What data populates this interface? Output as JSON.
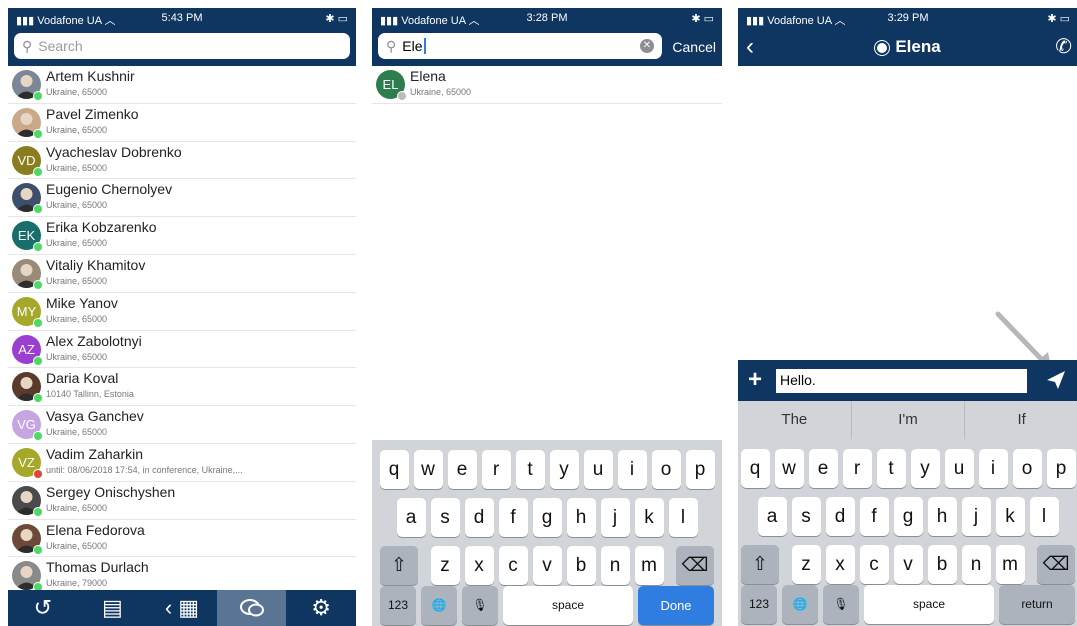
{
  "screens": [
    {
      "status": {
        "carrier": "Vodafone UA",
        "time": "5:43 PM"
      },
      "search_placeholder": "Search",
      "contacts": [
        {
          "name": "Artem Kushnir",
          "sub": "Ukraine, 65000",
          "initials": "",
          "color": "#7b8796",
          "presence": "#4cd964"
        },
        {
          "name": "Pavel Zimenko",
          "sub": "Ukraine, 65000",
          "initials": "",
          "color": "#c9a98a",
          "presence": "#4cd964"
        },
        {
          "name": "Vyacheslav Dobrenko",
          "sub": "Ukraine, 65000",
          "initials": "VD",
          "color": "#8a7d1f",
          "presence": "#4cd964"
        },
        {
          "name": "Eugenio Chernolyev",
          "sub": "Ukraine, 65000",
          "initials": "",
          "color": "#3d4f6b",
          "presence": "#4cd964"
        },
        {
          "name": "Erika Kobzarenko",
          "sub": "Ukraine, 65000",
          "initials": "EK",
          "color": "#176e6a",
          "presence": "#4cd964"
        },
        {
          "name": "Vitaliy Khamitov",
          "sub": "Ukraine, 65000",
          "initials": "",
          "color": "#9a8a7a",
          "presence": "#4cd964"
        },
        {
          "name": "Mike Yanov",
          "sub": "Ukraine, 65000",
          "initials": "MY",
          "color": "#a5a829",
          "presence": "#4cd964"
        },
        {
          "name": "Alex Zabolotnyi",
          "sub": "Ukraine, 65000",
          "initials": "AZ",
          "color": "#9a3fcf",
          "presence": "#4cd964"
        },
        {
          "name": "Daria Koval",
          "sub": "10140 Tallinn, Estonia",
          "initials": "",
          "color": "#5a3a2a",
          "presence": "#4cd964"
        },
        {
          "name": "Vasya Ganchev",
          "sub": "Ukraine, 65000",
          "initials": "VG",
          "color": "#c6a6e0",
          "presence": "#4cd964"
        },
        {
          "name": "Vadim Zaharkin",
          "sub": "until: 08/06/2018 17:54, in conference, Ukraine,...",
          "initials": "VZ",
          "color": "#a5a829",
          "presence": "#e0453a"
        },
        {
          "name": "Sergey Onischyshen",
          "sub": "Ukraine, 65000",
          "initials": "",
          "color": "#4a4a4a",
          "presence": "#4cd964"
        },
        {
          "name": "Elena Fedorova",
          "sub": "Ukraine, 65000",
          "initials": "",
          "color": "#6b4a3a",
          "presence": "#4cd964"
        },
        {
          "name": "Thomas Durlach",
          "sub": "Ukraine, 79000",
          "initials": "",
          "color": "#8a8a8a",
          "presence": "#4cd964"
        }
      ],
      "tabs": [
        {
          "icon": "history-icon",
          "glyph": "↺"
        },
        {
          "icon": "notebook-icon",
          "glyph": "▤"
        },
        {
          "icon": "dialpad-icon",
          "glyph": "‹ ▦"
        },
        {
          "icon": "chat-icon",
          "glyph": "💬"
        },
        {
          "icon": "settings-icon",
          "glyph": "⚙"
        }
      ]
    },
    {
      "status": {
        "carrier": "Vodafone UA",
        "time": "3:28 PM"
      },
      "search_value": "Ele",
      "cancel_label": "Cancel",
      "result": {
        "name": "Elena",
        "sub": "Ukraine, 65000",
        "initials": "EL",
        "color": "#2e7d4f"
      },
      "keyboard": {
        "row1": [
          "q",
          "w",
          "e",
          "r",
          "t",
          "y",
          "u",
          "i",
          "o",
          "p"
        ],
        "row2": [
          "a",
          "s",
          "d",
          "f",
          "g",
          "h",
          "j",
          "k",
          "l"
        ],
        "row3": [
          "z",
          "x",
          "c",
          "v",
          "b",
          "n",
          "m"
        ],
        "num": "123",
        "space": "space",
        "action": "Done"
      }
    },
    {
      "status": {
        "carrier": "Vodafone UA",
        "time": "3:29 PM"
      },
      "title": "Elena",
      "message_value": "Hello.",
      "suggestions": [
        "The",
        "I'm",
        "If"
      ],
      "keyboard": {
        "row1": [
          "q",
          "w",
          "e",
          "r",
          "t",
          "y",
          "u",
          "i",
          "o",
          "p"
        ],
        "row2": [
          "a",
          "s",
          "d",
          "f",
          "g",
          "h",
          "j",
          "k",
          "l"
        ],
        "row3": [
          "z",
          "x",
          "c",
          "v",
          "b",
          "n",
          "m"
        ],
        "num": "123",
        "space": "space",
        "action": "return"
      }
    }
  ]
}
